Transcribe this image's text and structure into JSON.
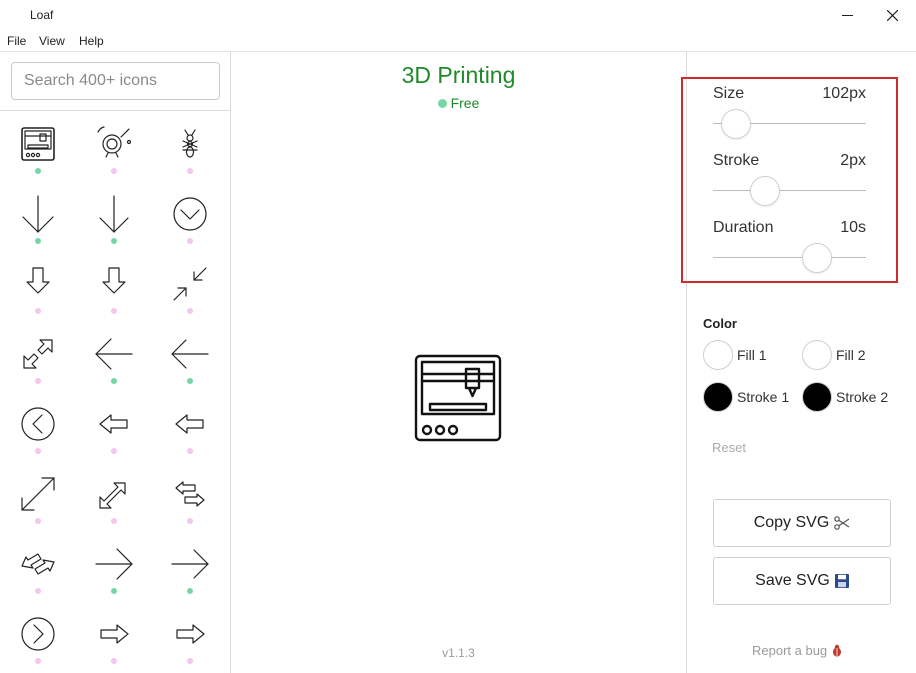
{
  "window": {
    "title": "Loaf"
  },
  "menu": {
    "items": [
      "File",
      "View",
      "Help"
    ]
  },
  "search": {
    "placeholder": "Search 400+ icons"
  },
  "icon_list": [
    {
      "icon": "3d-printer-icon",
      "tier": "free"
    },
    {
      "icon": "alarm-bell-icon",
      "tier": "pro"
    },
    {
      "icon": "ant-icon",
      "tier": "pro"
    },
    {
      "icon": "arrow-down-icon",
      "tier": "free"
    },
    {
      "icon": "arrow-down-thin-icon",
      "tier": "free"
    },
    {
      "icon": "arrow-down-circle-icon",
      "tier": "pro"
    },
    {
      "icon": "arrow-down-outline-icon",
      "tier": "pro"
    },
    {
      "icon": "arrow-down-outline-alt-icon",
      "tier": "pro"
    },
    {
      "icon": "arrows-collapse-diagonal-icon",
      "tier": "pro"
    },
    {
      "icon": "arrows-expand-diagonal-outline-icon",
      "tier": "pro"
    },
    {
      "icon": "arrow-left-icon",
      "tier": "free"
    },
    {
      "icon": "arrow-left-thin-icon",
      "tier": "free"
    },
    {
      "icon": "arrow-left-circle-icon",
      "tier": "pro"
    },
    {
      "icon": "arrow-left-outline-icon",
      "tier": "pro"
    },
    {
      "icon": "arrow-left-outline-alt-icon",
      "tier": "pro"
    },
    {
      "icon": "arrows-expand-diagonal-icon",
      "tier": "pro"
    },
    {
      "icon": "arrow-double-diagonal-outline-icon",
      "tier": "pro"
    },
    {
      "icon": "arrows-swap-outline-icon",
      "tier": "pro"
    },
    {
      "icon": "arrows-swap-diagonal-outline-icon",
      "tier": "pro"
    },
    {
      "icon": "arrow-right-icon",
      "tier": "free"
    },
    {
      "icon": "arrow-right-thin-icon",
      "tier": "free"
    },
    {
      "icon": "arrow-right-circle-icon",
      "tier": "pro"
    },
    {
      "icon": "arrow-right-outline-icon",
      "tier": "pro"
    },
    {
      "icon": "arrow-right-outline-alt-icon",
      "tier": "pro"
    }
  ],
  "selected": {
    "title": "3D Printing",
    "badge": "Free"
  },
  "settings": {
    "size": {
      "label": "Size",
      "value": "102px",
      "level": 0.15
    },
    "stroke": {
      "label": "Stroke",
      "value": "2px",
      "level": 0.34
    },
    "duration": {
      "label": "Duration",
      "value": "10s",
      "level": 0.68
    }
  },
  "color": {
    "heading": "Color",
    "fill1": {
      "label": "Fill 1",
      "value": "#ffffff"
    },
    "fill2": {
      "label": "Fill 2",
      "value": "#ffffff"
    },
    "stroke1": {
      "label": "Stroke 1",
      "value": "#000000"
    },
    "stroke2": {
      "label": "Stroke 2",
      "value": "#000000"
    }
  },
  "reset_label": "Reset",
  "copy_label": "Copy SVG",
  "save_label": "Save SVG",
  "report_label": "Report a bug",
  "version": "v1.1.3",
  "colors": {
    "accent": "#1f8a2a",
    "free_dot": "#76d7a4",
    "pro_dot": "#f3c6ec",
    "highlight": "#d22a2a"
  }
}
